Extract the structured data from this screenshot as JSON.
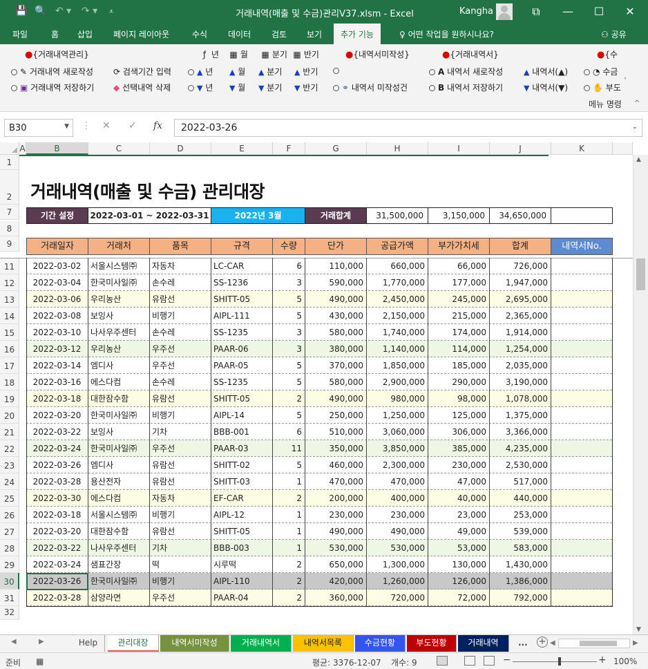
{
  "window": {
    "title": "거래내역(매출 및 수금)관리V37.xlsm  -  Excel",
    "user": "Kangha",
    "controls": [
      "⧉",
      "—",
      "☐",
      "✕"
    ]
  },
  "ribbon": {
    "tabs": [
      "파일",
      "홈",
      "삽입",
      "페이지 레이아웃",
      "수식",
      "데이터",
      "검토",
      "보기",
      "추가 기능"
    ],
    "tell_me": "어떤 작업을 원하시나요?",
    "share": "공유",
    "caption": "메뉴 명령",
    "groups": {
      "g1_title": "{거래내역관리}",
      "g1_new": "거래내역 새로작성",
      "g1_save": "거래내역 저장하기",
      "g2_search": "검색기간 입력",
      "g2_delete": "선택내역 삭제",
      "period_year": "년",
      "period_month": "월",
      "period_quarter": "분기",
      "period_half": "반기",
      "g3_title": "{내역서미작성}",
      "g3_cond": "내역서 미작성건",
      "g4_title": "{거래내역서}",
      "g4_new": "내역서 새로작성",
      "g4_save": "내역서 저장하기",
      "g4_up": "내역서(▲)",
      "g4_down": "내역서(▼)",
      "g5_title": "{수",
      "g5_item1": "수금",
      "g5_item2": "부도"
    }
  },
  "formula_bar": {
    "name_box": "B30",
    "formula": "2022-03-26"
  },
  "grid": {
    "columns": [
      "A",
      "B",
      "C",
      "D",
      "E",
      "F",
      "G",
      "H",
      "I",
      "J",
      "K"
    ],
    "rows": [
      "1",
      "2",
      "7",
      "8",
      "9",
      "11",
      "12",
      "13",
      "14",
      "15",
      "16",
      "17",
      "18",
      "19",
      "20",
      "21",
      "22",
      "23",
      "24",
      "25",
      "26",
      "27",
      "28",
      "29",
      "30",
      "31",
      "32"
    ]
  },
  "sheet": {
    "title": "거래내역(매출 및 수금) 관리대장",
    "period_label": "기간 설정",
    "period_range": "2022-03-01  ~  2022-03-31",
    "period_month": "2022년 3월",
    "total_label": "거래합계",
    "total_supply": "31,500,000",
    "total_vat": "3,150,000",
    "total_sum": "34,650,000",
    "headers": [
      "거래일자",
      "거래처",
      "품목",
      "규격",
      "수량",
      "단가",
      "공급가액",
      "부가가치세",
      "합계",
      "내역서No."
    ],
    "rows": [
      {
        "date": "2022-03-02",
        "client": "서울시스템㈜",
        "item": "자동차",
        "spec": "LC-CAR",
        "qty": "6",
        "price": "110,000",
        "supply": "660,000",
        "vat": "66,000",
        "total": "726,000",
        "no": ""
      },
      {
        "date": "2022-03-04",
        "client": "한국미사일㈜",
        "item": "손수레",
        "spec": "SS-1236",
        "qty": "3",
        "price": "590,000",
        "supply": "1,770,000",
        "vat": "177,000",
        "total": "1,947,000",
        "no": ""
      },
      {
        "date": "2022-03-06",
        "client": "우리농산",
        "item": "유람선",
        "spec": "SHITT-05",
        "qty": "5",
        "price": "490,000",
        "supply": "2,450,000",
        "vat": "245,000",
        "total": "2,695,000",
        "no": ""
      },
      {
        "date": "2022-03-08",
        "client": "보잉사",
        "item": "비행기",
        "spec": "AIPL-111",
        "qty": "5",
        "price": "430,000",
        "supply": "2,150,000",
        "vat": "215,000",
        "total": "2,365,000",
        "no": ""
      },
      {
        "date": "2022-03-10",
        "client": "나사우주센터",
        "item": "손수레",
        "spec": "SS-1235",
        "qty": "3",
        "price": "580,000",
        "supply": "1,740,000",
        "vat": "174,000",
        "total": "1,914,000",
        "no": ""
      },
      {
        "date": "2022-03-12",
        "client": "우리농산",
        "item": "우주선",
        "spec": "PAAR-06",
        "qty": "3",
        "price": "380,000",
        "supply": "1,140,000",
        "vat": "114,000",
        "total": "1,254,000",
        "no": ""
      },
      {
        "date": "2022-03-14",
        "client": "엠디사",
        "item": "우주선",
        "spec": "PAAR-05",
        "qty": "5",
        "price": "370,000",
        "supply": "1,850,000",
        "vat": "185,000",
        "total": "2,035,000",
        "no": ""
      },
      {
        "date": "2022-03-16",
        "client": "에스다컴",
        "item": "손수레",
        "spec": "SS-1235",
        "qty": "5",
        "price": "580,000",
        "supply": "2,900,000",
        "vat": "290,000",
        "total": "3,190,000",
        "no": ""
      },
      {
        "date": "2022-03-18",
        "client": "대한잠수함",
        "item": "유람선",
        "spec": "SHITT-05",
        "qty": "2",
        "price": "490,000",
        "supply": "980,000",
        "vat": "98,000",
        "total": "1,078,000",
        "no": ""
      },
      {
        "date": "2022-03-20",
        "client": "한국미사일㈜",
        "item": "비행기",
        "spec": "AIPL-14",
        "qty": "5",
        "price": "250,000",
        "supply": "1,250,000",
        "vat": "125,000",
        "total": "1,375,000",
        "no": ""
      },
      {
        "date": "2022-03-22",
        "client": "보잉사",
        "item": "기차",
        "spec": "BBB-001",
        "qty": "6",
        "price": "510,000",
        "supply": "3,060,000",
        "vat": "306,000",
        "total": "3,366,000",
        "no": ""
      },
      {
        "date": "2022-03-24",
        "client": "한국미사일㈜",
        "item": "우주선",
        "spec": "PAAR-03",
        "qty": "11",
        "price": "350,000",
        "supply": "3,850,000",
        "vat": "385,000",
        "total": "4,235,000",
        "no": ""
      },
      {
        "date": "2022-03-26",
        "client": "엠디사",
        "item": "유람선",
        "spec": "SHITT-02",
        "qty": "5",
        "price": "460,000",
        "supply": "2,300,000",
        "vat": "230,000",
        "total": "2,530,000",
        "no": ""
      },
      {
        "date": "2022-03-28",
        "client": "용산전자",
        "item": "유람선",
        "spec": "SHITT-03",
        "qty": "1",
        "price": "470,000",
        "supply": "470,000",
        "vat": "47,000",
        "total": "517,000",
        "no": ""
      },
      {
        "date": "2022-03-30",
        "client": "에스다컴",
        "item": "자동차",
        "spec": "EF-CAR",
        "qty": "2",
        "price": "200,000",
        "supply": "400,000",
        "vat": "40,000",
        "total": "440,000",
        "no": ""
      },
      {
        "date": "2022-03-18",
        "client": "서울시스템㈜",
        "item": "비행기",
        "spec": "AIPL-12",
        "qty": "1",
        "price": "230,000",
        "supply": "230,000",
        "vat": "23,000",
        "total": "253,000",
        "no": ""
      },
      {
        "date": "2022-03-20",
        "client": "대한잠수함",
        "item": "유람선",
        "spec": "SHITT-05",
        "qty": "1",
        "price": "490,000",
        "supply": "490,000",
        "vat": "49,000",
        "total": "539,000",
        "no": ""
      },
      {
        "date": "2022-03-22",
        "client": "나사우주센터",
        "item": "기차",
        "spec": "BBB-003",
        "qty": "1",
        "price": "530,000",
        "supply": "530,000",
        "vat": "53,000",
        "total": "583,000",
        "no": ""
      },
      {
        "date": "2022-03-24",
        "client": "샘표간장",
        "item": "떡",
        "spec": "시루떡",
        "qty": "2",
        "price": "650,000",
        "supply": "1,300,000",
        "vat": "130,000",
        "total": "1,430,000",
        "no": ""
      },
      {
        "date": "2022-03-26",
        "client": "한국미사일㈜",
        "item": "비행기",
        "spec": "AIPL-110",
        "qty": "2",
        "price": "420,000",
        "supply": "1,260,000",
        "vat": "126,000",
        "total": "1,386,000",
        "no": ""
      },
      {
        "date": "2022-03-28",
        "client": "삼양라면",
        "item": "우주선",
        "spec": "PAAR-04",
        "qty": "2",
        "price": "360,000",
        "supply": "720,000",
        "vat": "72,000",
        "total": "792,000",
        "no": ""
      }
    ],
    "row_fill": [
      "w",
      "w",
      "y",
      "w",
      "w",
      "g",
      "w",
      "w",
      "y",
      "w",
      "w",
      "g",
      "w",
      "w",
      "y",
      "w",
      "w",
      "g",
      "w",
      "s",
      "y"
    ]
  },
  "sheet_tabs": [
    {
      "label": "Help",
      "color": "#f3f3f3",
      "kind": "plain"
    },
    {
      "label": "관리대장",
      "color": "#ffffff",
      "kind": "active"
    },
    {
      "label": "내역서미작성",
      "color": "#76923c",
      "kind": "color"
    },
    {
      "label": "거래내역서",
      "color": "#00b050",
      "kind": "color"
    },
    {
      "label": "내역서목록",
      "color": "#ffc000",
      "kind": "color"
    },
    {
      "label": "수금현황",
      "color": "#3355ee",
      "kind": "color"
    },
    {
      "label": "부도현황",
      "color": "#c00000",
      "kind": "color"
    },
    {
      "label": "거래내역",
      "color": "#002060",
      "kind": "color"
    }
  ],
  "sheet_more": "...",
  "status": {
    "mode": "준비",
    "average": "평균: 3376-12-07",
    "count": "개수: 9",
    "zoom": "100%"
  }
}
